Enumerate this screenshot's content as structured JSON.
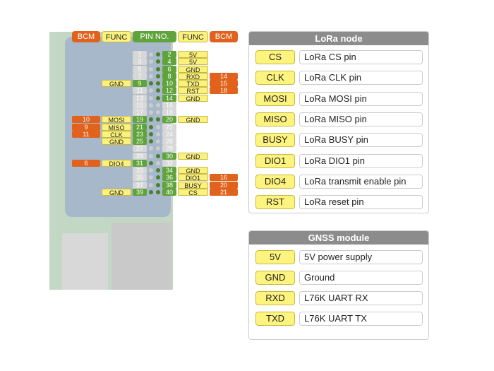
{
  "header": {
    "bcm_left": "BCM",
    "func_left": "FUNC",
    "pin_no": "PIN NO.",
    "func_right": "FUNC",
    "bcm_right": "BCM"
  },
  "colors": {
    "bcm": "#e0621c",
    "func": "#fbf27e",
    "pin_active": "#5fa33a",
    "pin_inactive": "#d7d7d7",
    "panel_header": "#8c8c8c"
  },
  "pins": [
    {
      "l": 1,
      "r": 2,
      "rf": "5V"
    },
    {
      "l": 3,
      "r": 4,
      "rf": "5V"
    },
    {
      "l": 5,
      "r": 6,
      "rf": "GND"
    },
    {
      "l": 7,
      "r": 8,
      "rf": "RXD",
      "rb": "14"
    },
    {
      "l": 9,
      "lf": "GND",
      "r": 10,
      "rf": "TXD",
      "rb": "15"
    },
    {
      "l": 11,
      "r": 12,
      "rf": "RST",
      "rb": "18"
    },
    {
      "l": 13,
      "r": 14,
      "rf": "GND"
    },
    {
      "l": 15,
      "r": 16
    },
    {
      "l": 17,
      "r": 18
    },
    {
      "l": 19,
      "lf": "MOSI",
      "lb": "10",
      "r": 20,
      "rf": "GND"
    },
    {
      "l": 21,
      "lf": "MISO",
      "lb": "9",
      "r": 22
    },
    {
      "l": 23,
      "lf": "CLK",
      "lb": "11",
      "r": 24
    },
    {
      "l": 25,
      "lf": "GND",
      "r": 26
    },
    {
      "l": 27,
      "r": 28
    },
    {
      "l": 29,
      "r": 30,
      "rf": "GND"
    },
    {
      "l": 31,
      "lf": "DIO4",
      "lb": "6",
      "r": 32
    },
    {
      "l": 33,
      "r": 34,
      "rf": "GND"
    },
    {
      "l": 35,
      "r": 36,
      "rf": "DIO1",
      "rb": "16"
    },
    {
      "l": 37,
      "r": 38,
      "rf": "BUSY",
      "rb": "20"
    },
    {
      "l": 39,
      "lf": "GND",
      "r": 40,
      "rf": "CS",
      "rb": "21"
    }
  ],
  "lora": {
    "title": "LoRa node",
    "rows": [
      {
        "pin": "CS",
        "desc": "LoRa CS pin"
      },
      {
        "pin": "CLK",
        "desc": "LoRa CLK pin"
      },
      {
        "pin": "MOSI",
        "desc": "LoRa MOSI pin"
      },
      {
        "pin": "MISO",
        "desc": "LoRa MISO pin"
      },
      {
        "pin": "BUSY",
        "desc": "LoRa BUSY pin"
      },
      {
        "pin": "DIO1",
        "desc": "LoRa DIO1 pin"
      },
      {
        "pin": "DIO4",
        "desc": "LoRa transmit enable pin"
      },
      {
        "pin": "RST",
        "desc": "LoRa reset pin"
      }
    ]
  },
  "gnss": {
    "title": "GNSS module",
    "rows": [
      {
        "pin": "5V",
        "desc": "5V power supply"
      },
      {
        "pin": "GND",
        "desc": "Ground"
      },
      {
        "pin": "RXD",
        "desc": "L76K UART RX"
      },
      {
        "pin": "TXD",
        "desc": "L76K UART TX"
      }
    ]
  }
}
